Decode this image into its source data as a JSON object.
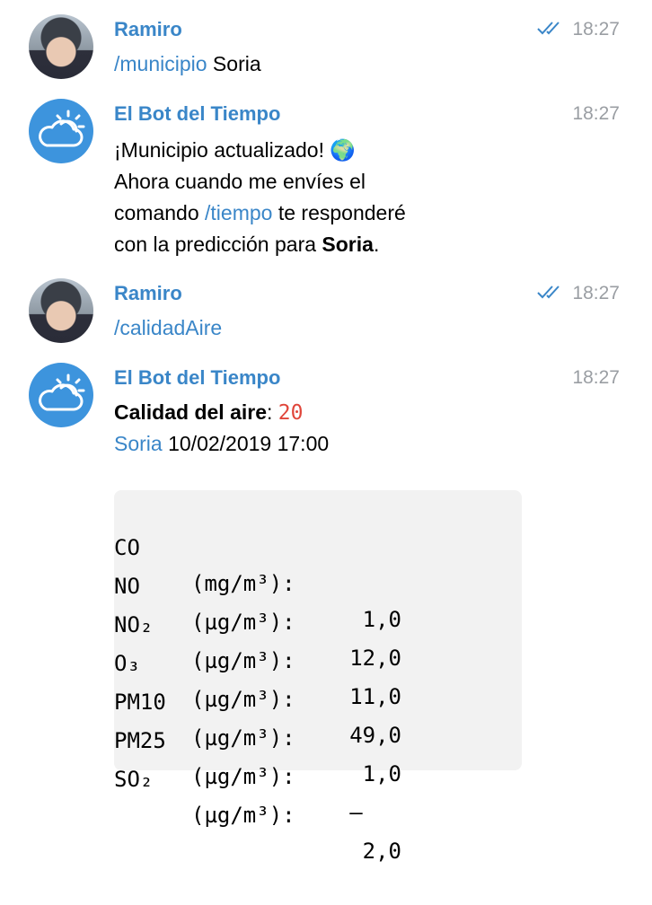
{
  "messages": [
    {
      "sender": "Ramiro",
      "time": "18:27",
      "command": "/municipio",
      "rest": " Soria"
    },
    {
      "sender": "El Bot del Tiempo",
      "time": "18:27",
      "line1": "¡Municipio actualizado! 🌍",
      "line2": "Ahora cuando me envíes el",
      "line3_pre": "comando ",
      "line3_cmd": "/tiempo",
      "line3_post": " te responderé",
      "line4_pre": "con la predicción para ",
      "line4_bold": "Soria",
      "line4_post": "."
    },
    {
      "sender": "Ramiro",
      "time": "18:27",
      "command": "/calidadAire"
    },
    {
      "sender": "El Bot del Tiempo",
      "time": "18:27",
      "air_label": "Calidad del aire",
      "air_sep": ": ",
      "air_value": "20",
      "place": "Soria",
      "datetime": " 10/02/2019 17:00",
      "table": [
        {
          "pollutant": "CO",
          "unit": "(mg/m³):",
          "value": "1,0"
        },
        {
          "pollutant": "NO",
          "unit": "(µg/m³):",
          "value": "12,0"
        },
        {
          "pollutant": "NO₂",
          "unit": "(µg/m³):",
          "value": "11,0"
        },
        {
          "pollutant": "O₃",
          "unit": "(µg/m³):",
          "value": "49,0"
        },
        {
          "pollutant": "PM10",
          "unit": "(µg/m³):",
          "value": "1,0"
        },
        {
          "pollutant": "PM25",
          "unit": "(µg/m³):",
          "value": "–   "
        },
        {
          "pollutant": "SO₂",
          "unit": "(µg/m³):",
          "value": "2,0"
        }
      ]
    }
  ],
  "icons": {
    "user_avatar": "user-photo",
    "bot_avatar": "sun-cloud-icon",
    "read_status": "double-check-icon"
  },
  "colors": {
    "link": "#3a86c8",
    "accent_number": "#e0463b",
    "bot_avatar_bg": "#3d94dd",
    "timestamp": "#9a9ea3"
  }
}
